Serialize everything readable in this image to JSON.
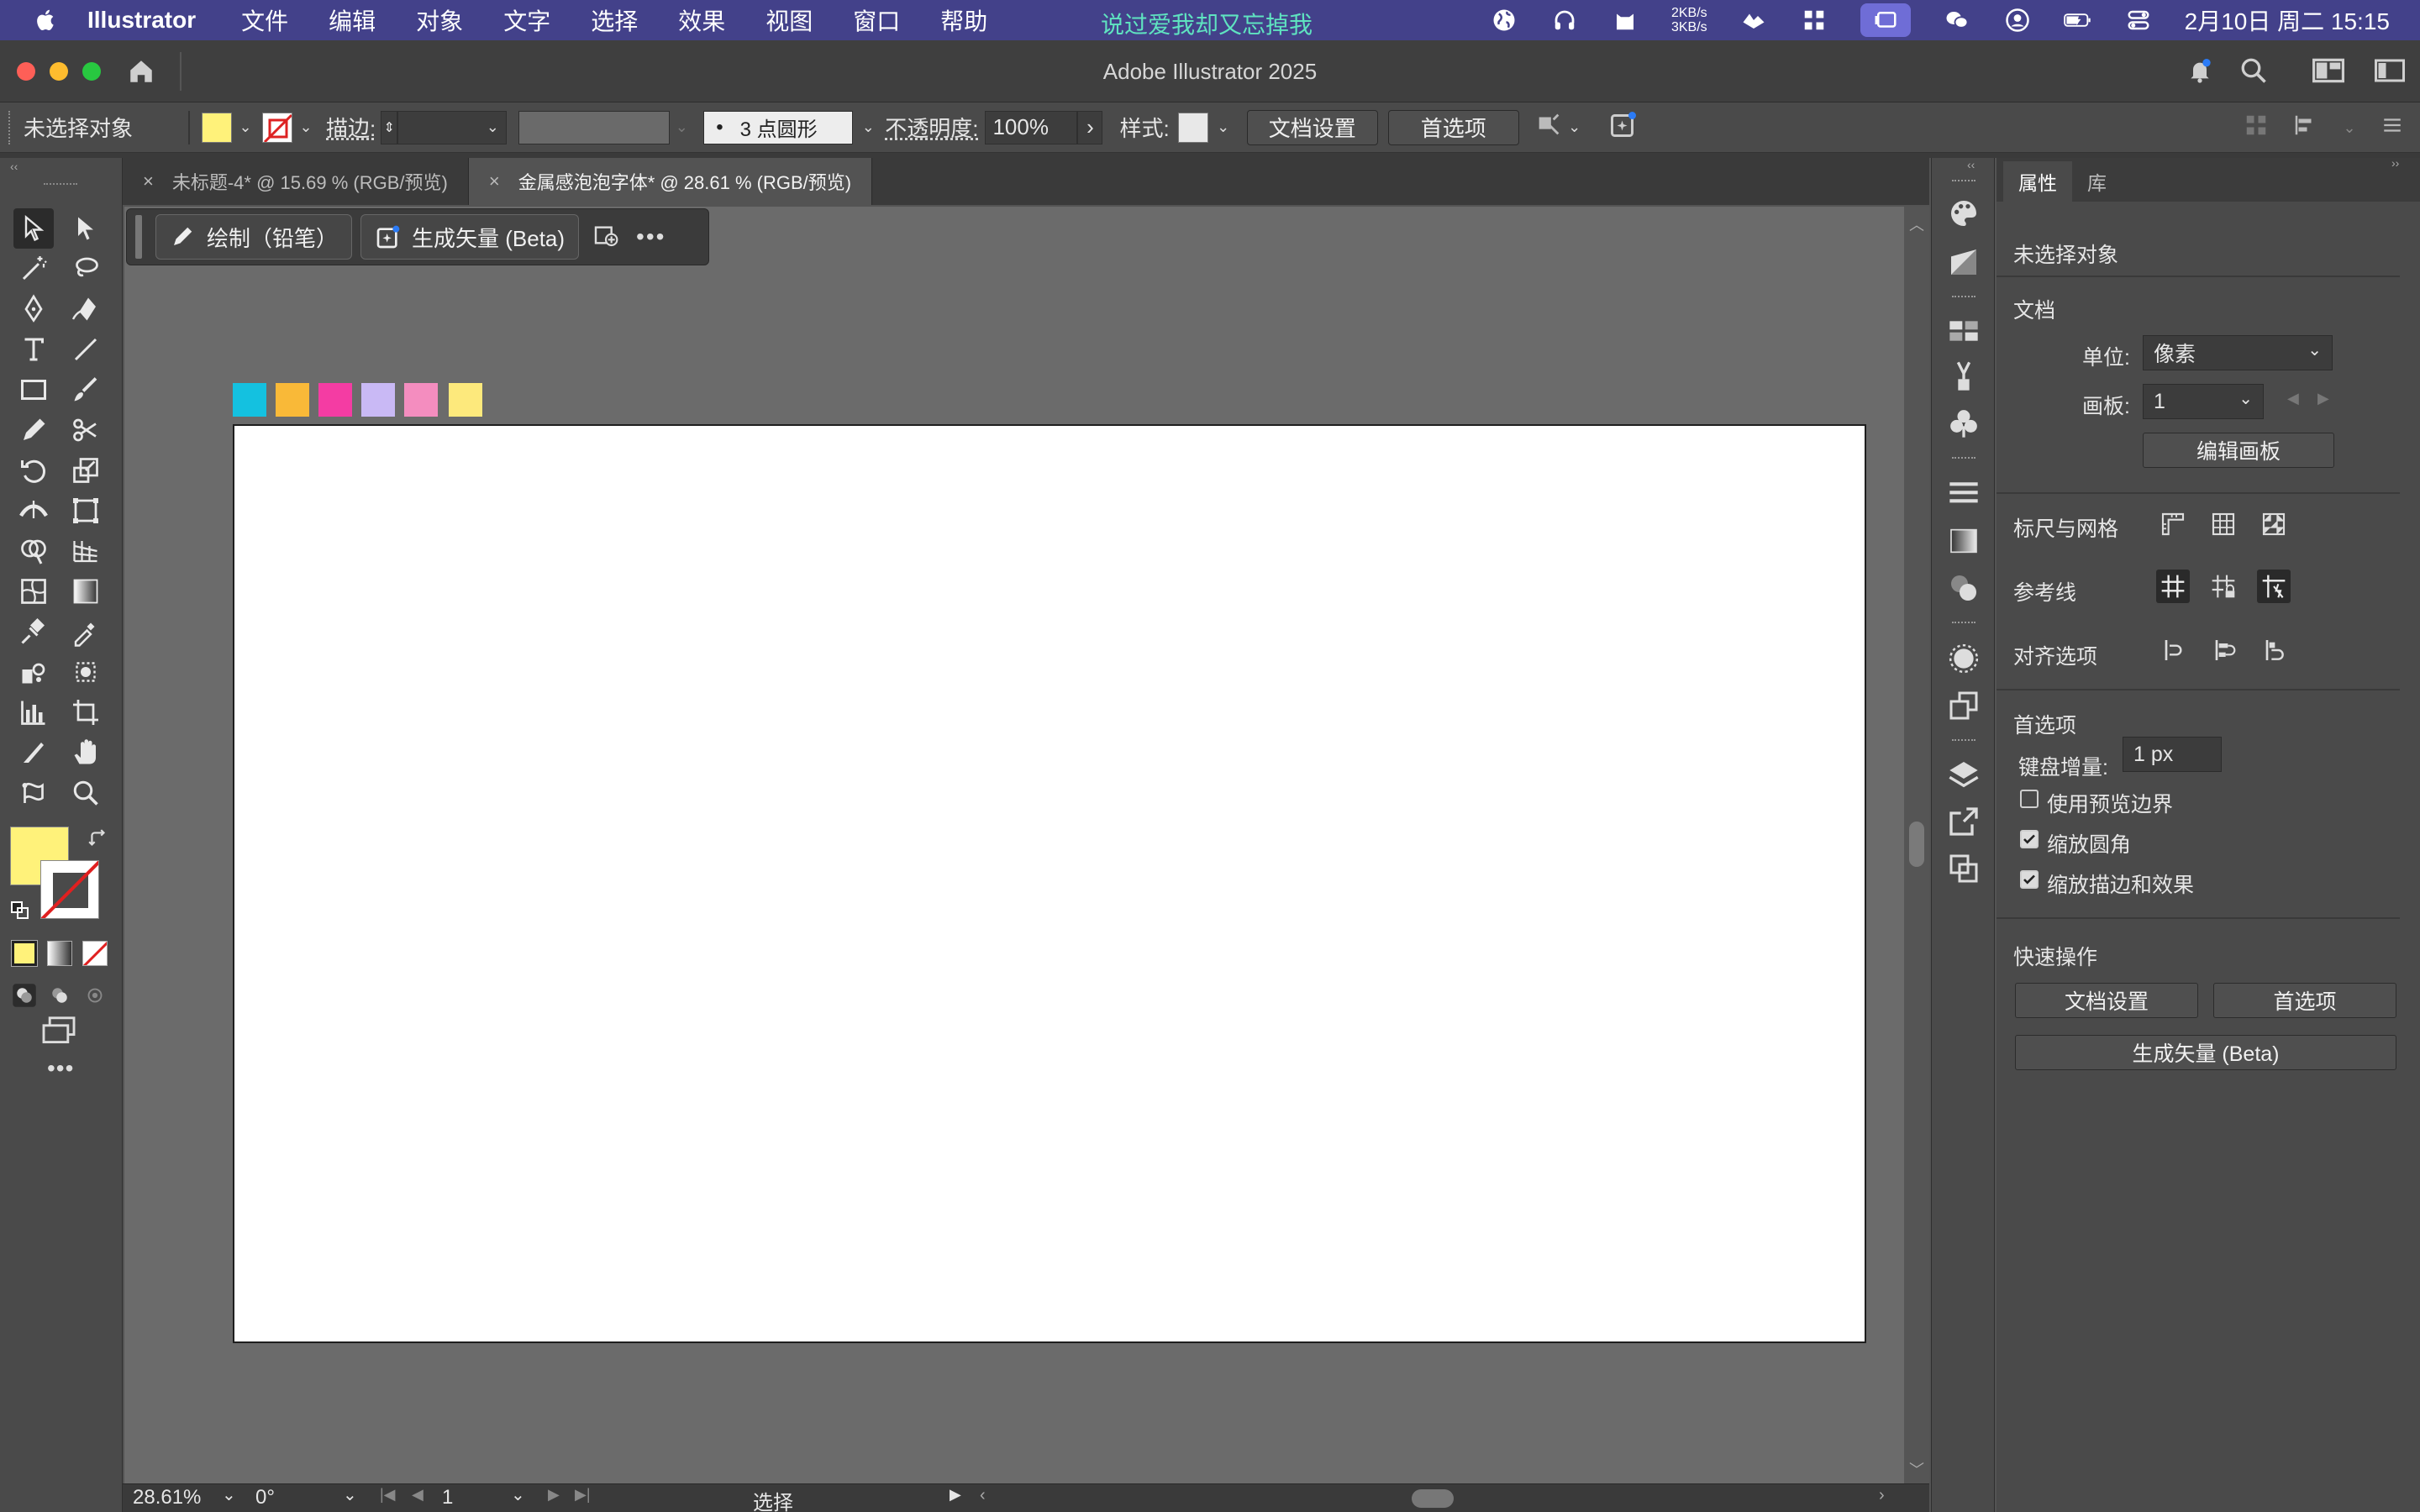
{
  "menubar": {
    "app_name": "Illustrator",
    "items": [
      "文件",
      "编辑",
      "对象",
      "文字",
      "选择",
      "效果",
      "视图",
      "窗口",
      "帮助"
    ],
    "center_text": "说过爱我却又忘掉我",
    "net_up": "2KB/s",
    "net_down": "3KB/s",
    "clock": "2月10日 周二  15:15"
  },
  "window": {
    "title": "Adobe Illustrator 2025"
  },
  "control_bar": {
    "selection_label": "未选择对象",
    "stroke_label": "描边:",
    "brush_label": "3 点圆形",
    "opacity_label": "不透明度:",
    "opacity_value": "100%",
    "style_label": "样式:",
    "doc_setup_button": "文档设置",
    "prefs_button": "首选项",
    "fill_color": "#fff27a"
  },
  "tabs": [
    {
      "label": "未标题-4* @ 15.69 % (RGB/预览)",
      "active": false
    },
    {
      "label": "金属感泡泡字体* @ 28.61 % (RGB/预览)",
      "active": true
    }
  ],
  "context_bar": {
    "draw_button": "绘制（铅笔）",
    "generate_button": "生成矢量 (Beta)"
  },
  "canvas": {
    "color_swatches": [
      "#14c1e0",
      "#f9b938",
      "#f43ca3",
      "#c9b9f5",
      "#f48dbf",
      "#fde97c"
    ]
  },
  "properties": {
    "tab_properties": "属性",
    "tab_libraries": "库",
    "no_selection": "未选择对象",
    "document_title": "文档",
    "units_label": "单位:",
    "units_value": "像素",
    "artboard_label": "画板:",
    "artboard_value": "1",
    "edit_artboard_button": "编辑画板",
    "rulers_grids_label": "标尺与网格",
    "guides_label": "参考线",
    "snap_options_label": "对齐选项",
    "preferences_title": "首选项",
    "keyboard_increment_label": "键盘增量:",
    "keyboard_increment_value": "1 px",
    "use_preview_bounds": "使用预览边界",
    "scale_corners": "缩放圆角",
    "scale_strokes": "缩放描边和效果",
    "quick_actions_title": "快速操作",
    "qa_doc_setup": "文档设置",
    "qa_prefs": "首选项",
    "qa_generate": "生成矢量 (Beta)"
  },
  "statusbar": {
    "zoom": "28.61%",
    "rotation": "0°",
    "artboard_num": "1",
    "tool_name": "选择"
  }
}
